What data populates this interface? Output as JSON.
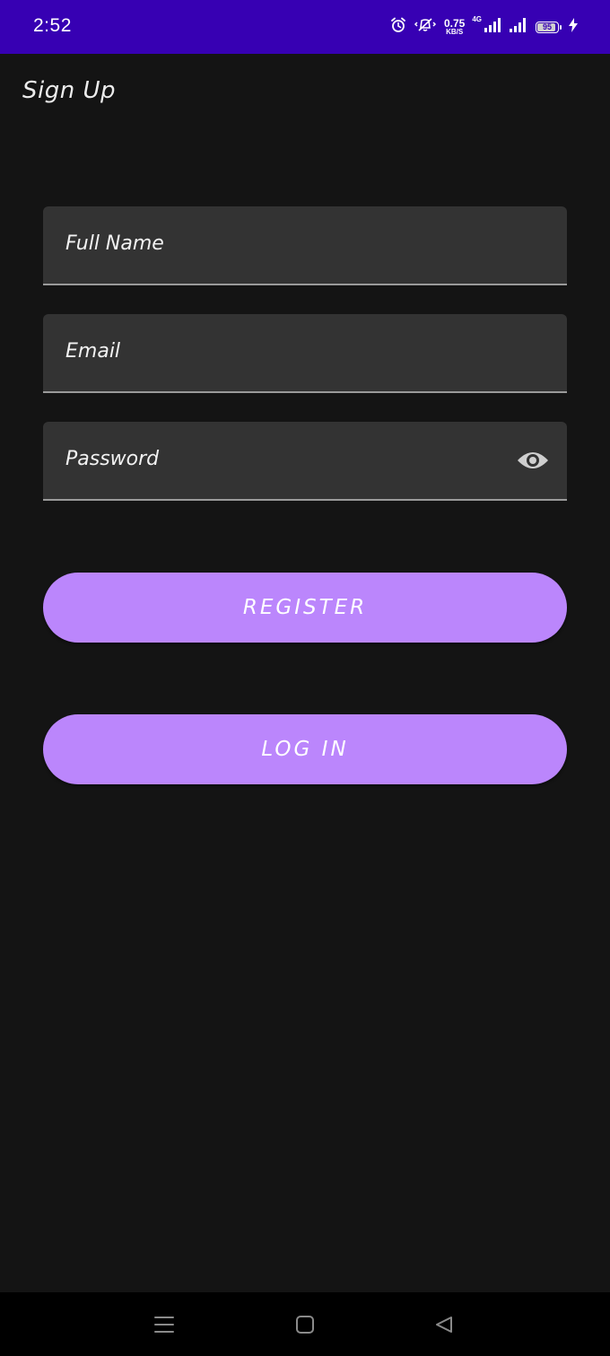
{
  "status_bar": {
    "time": "2:52",
    "net_speed_value": "0.75",
    "net_speed_unit": "KB/S",
    "network_type": "4G",
    "battery_level": "95",
    "icons": [
      "alarm-icon",
      "vibrate-icon",
      "signal-icon",
      "signal-icon",
      "battery-icon",
      "charging-icon"
    ]
  },
  "page": {
    "title": "Sign Up"
  },
  "form": {
    "full_name_label": "Full Name",
    "email_label": "Email",
    "password_label": "Password",
    "password_toggle_icon": "eye-icon"
  },
  "actions": {
    "register_label": "REGISTER",
    "login_label": "LOG IN"
  },
  "navigation": {
    "icons": [
      "menu-icon",
      "home-icon",
      "back-icon"
    ]
  },
  "colors": {
    "status_bar": "#3700b3",
    "background": "#141414",
    "field_background": "#333333",
    "button_accent": "#bb86fc"
  }
}
